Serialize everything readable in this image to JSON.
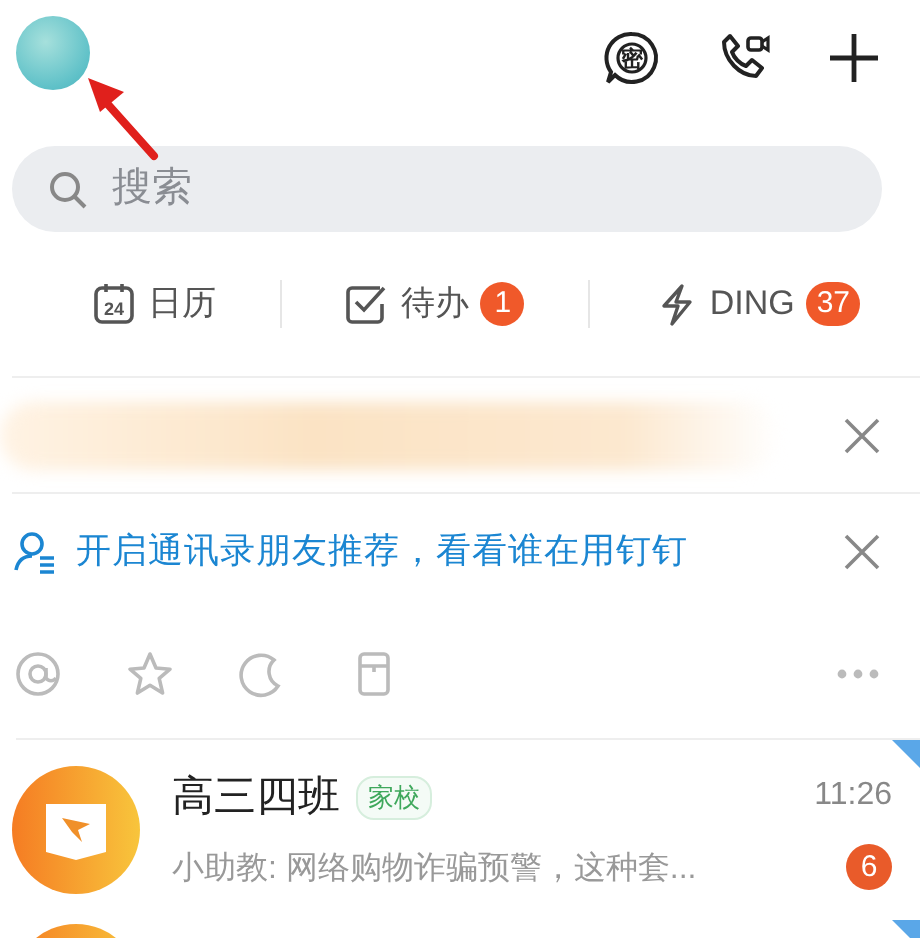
{
  "header": {
    "secret_chat_glyph": "密"
  },
  "search": {
    "placeholder": "搜索"
  },
  "shortcuts": [
    {
      "kind": "calendar",
      "label": "日历",
      "icon_text": "24"
    },
    {
      "kind": "todo",
      "label": "待办",
      "count": "1"
    },
    {
      "kind": "ding",
      "label": "DING",
      "count": "37"
    }
  ],
  "banners": [
    {
      "kind": "blurred"
    },
    {
      "kind": "contacts",
      "text": "开启通讯录朋友推荐，看看谁在用钉钉"
    }
  ],
  "filters": [
    {
      "kind": "mention"
    },
    {
      "kind": "star"
    },
    {
      "kind": "later"
    },
    {
      "kind": "doc"
    }
  ],
  "chats": [
    {
      "title": "高三四班",
      "tag": "家校",
      "time": "11:26",
      "preview": "小助教: 网络购物诈骗预警，这种套...",
      "unread": "6",
      "pinned": true
    },
    {
      "pinned": true
    }
  ]
}
